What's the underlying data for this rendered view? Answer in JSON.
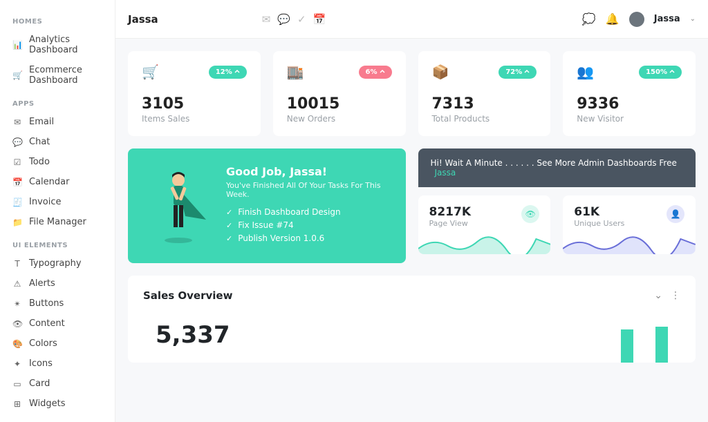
{
  "brand": "Jassa",
  "user": {
    "name": "Jassa"
  },
  "sidebar": {
    "sections": [
      {
        "label": "HOMES",
        "items": [
          {
            "icon": "📊",
            "label": "Analytics Dashboard"
          },
          {
            "icon": "🛒",
            "label": "Ecommerce Dashboard"
          }
        ]
      },
      {
        "label": "APPS",
        "items": [
          {
            "icon": "✉",
            "label": "Email"
          },
          {
            "icon": "💬",
            "label": "Chat"
          },
          {
            "icon": "☑",
            "label": "Todo"
          },
          {
            "icon": "📅",
            "label": "Calendar"
          },
          {
            "icon": "🧾",
            "label": "Invoice"
          },
          {
            "icon": "📁",
            "label": "File Manager"
          }
        ]
      },
      {
        "label": "UI ELEMENTS",
        "items": [
          {
            "icon": "T",
            "label": "Typography"
          },
          {
            "icon": "⚠",
            "label": "Alerts"
          },
          {
            "icon": "✴",
            "label": "Buttons"
          },
          {
            "icon": "👁",
            "label": "Content"
          },
          {
            "icon": "🎨",
            "label": "Colors"
          },
          {
            "icon": "✦",
            "label": "Icons"
          },
          {
            "icon": "▭",
            "label": "Card"
          },
          {
            "icon": "⊞",
            "label": "Widgets"
          }
        ]
      }
    ]
  },
  "stats": [
    {
      "icon": "🛒",
      "iconColor": "#5b7cfa",
      "badge": "12%",
      "badgeClass": "green",
      "value": "3105",
      "label": "Items Sales"
    },
    {
      "icon": "🏬",
      "iconColor": "#f85a6a",
      "badge": "6%",
      "badgeClass": "red",
      "value": "10015",
      "label": "New Orders"
    },
    {
      "icon": "📦",
      "iconColor": "#e6a621",
      "badge": "72%",
      "badgeClass": "green",
      "value": "7313",
      "label": "Total Products"
    },
    {
      "icon": "👥",
      "iconColor": "#3ed7b4",
      "badge": "150%",
      "badgeClass": "green",
      "value": "9336",
      "label": "New Visitor"
    }
  ],
  "hero": {
    "title": "Good Job, Jassa!",
    "subtitle": "You've Finished All Of Your Tasks For This Week.",
    "tasks": [
      "Finish Dashboard Design",
      "Fix Issue #74",
      "Publish Version 1.0.6"
    ]
  },
  "notice": {
    "text": "Hi! Wait A Minute . . . . . . See More Admin Dashboards Free",
    "link": "Jassa"
  },
  "mini": [
    {
      "value": "8217K",
      "label": "Page View",
      "iconClass": "teal",
      "icon": "👁",
      "stroke": "#3ed7b4",
      "fill": "#c9f3e9"
    },
    {
      "value": "61K",
      "label": "Unique Users",
      "iconClass": "blue",
      "icon": "👤",
      "stroke": "#6a6fd8",
      "fill": "#e0e3fb"
    }
  ],
  "sales": {
    "title": "Sales Overview",
    "big": "5,337"
  }
}
